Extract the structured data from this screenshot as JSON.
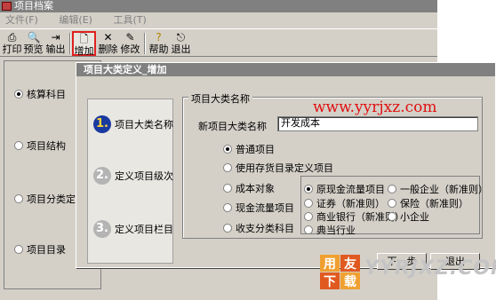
{
  "window": {
    "title": "项目档案"
  },
  "menu": [
    "文件(F)",
    "编辑(E)",
    "工具(T)"
  ],
  "toolbar": {
    "buttons": [
      {
        "label": "打印",
        "icon": "printer-icon"
      },
      {
        "label": "预览",
        "icon": "preview-icon"
      },
      {
        "label": "输出",
        "icon": "export-icon"
      },
      {
        "label": "增加",
        "icon": "add-icon",
        "selected": true
      },
      {
        "label": "删除",
        "icon": "delete-icon"
      },
      {
        "label": "修改",
        "icon": "edit-icon"
      },
      {
        "label": "帮助",
        "icon": "help-icon"
      },
      {
        "label": "退出",
        "icon": "exit-icon"
      }
    ]
  },
  "left_options": [
    {
      "label": "核算科目",
      "checked": true
    },
    {
      "label": "项目结构",
      "checked": false
    },
    {
      "label": "项目分类定义",
      "checked": false
    },
    {
      "label": "项目目录",
      "checked": false
    }
  ],
  "dialog": {
    "title": "项目大类定义_增加",
    "steps": [
      {
        "num": "1.",
        "label": "项目大类名称",
        "active": true
      },
      {
        "num": "2.",
        "label": "定义项目级次",
        "active": false
      },
      {
        "num": "3.",
        "label": "定义项目栏目",
        "active": false
      }
    ],
    "group_title": "项目大类名称",
    "name_label": "新项目大类名称",
    "name_value": "开发成本",
    "type_options": [
      {
        "label": "普通项目",
        "checked": true
      },
      {
        "label": "使用存货目录定义项目",
        "checked": false
      },
      {
        "label": "成本对象",
        "checked": false
      },
      {
        "label": "现金流量项目",
        "checked": false
      },
      {
        "label": "收支分类科目",
        "checked": false
      }
    ],
    "cashflow_options": [
      {
        "label": "原现金流量项目",
        "checked": true
      },
      {
        "label": "一般企业（新准则）",
        "checked": false
      },
      {
        "label": "证券（新准则）",
        "checked": false
      },
      {
        "label": "保险（新准则）",
        "checked": false
      },
      {
        "label": "商业银行（新准则）",
        "checked": false
      },
      {
        "label": "小企业",
        "checked": false
      },
      {
        "label": "典当行业",
        "checked": false
      }
    ],
    "next_label": "下一步",
    "exit_label": "退出"
  },
  "watermark": {
    "url": "www.yyrjxz.com",
    "logo_text": "YYRJXZ.COM",
    "logo_glyphs": [
      "用",
      "友",
      "下",
      "载"
    ]
  },
  "colors": {
    "accent_red": "#e02020",
    "step_active": "#1a3aa0",
    "watermark": "#e01010"
  }
}
